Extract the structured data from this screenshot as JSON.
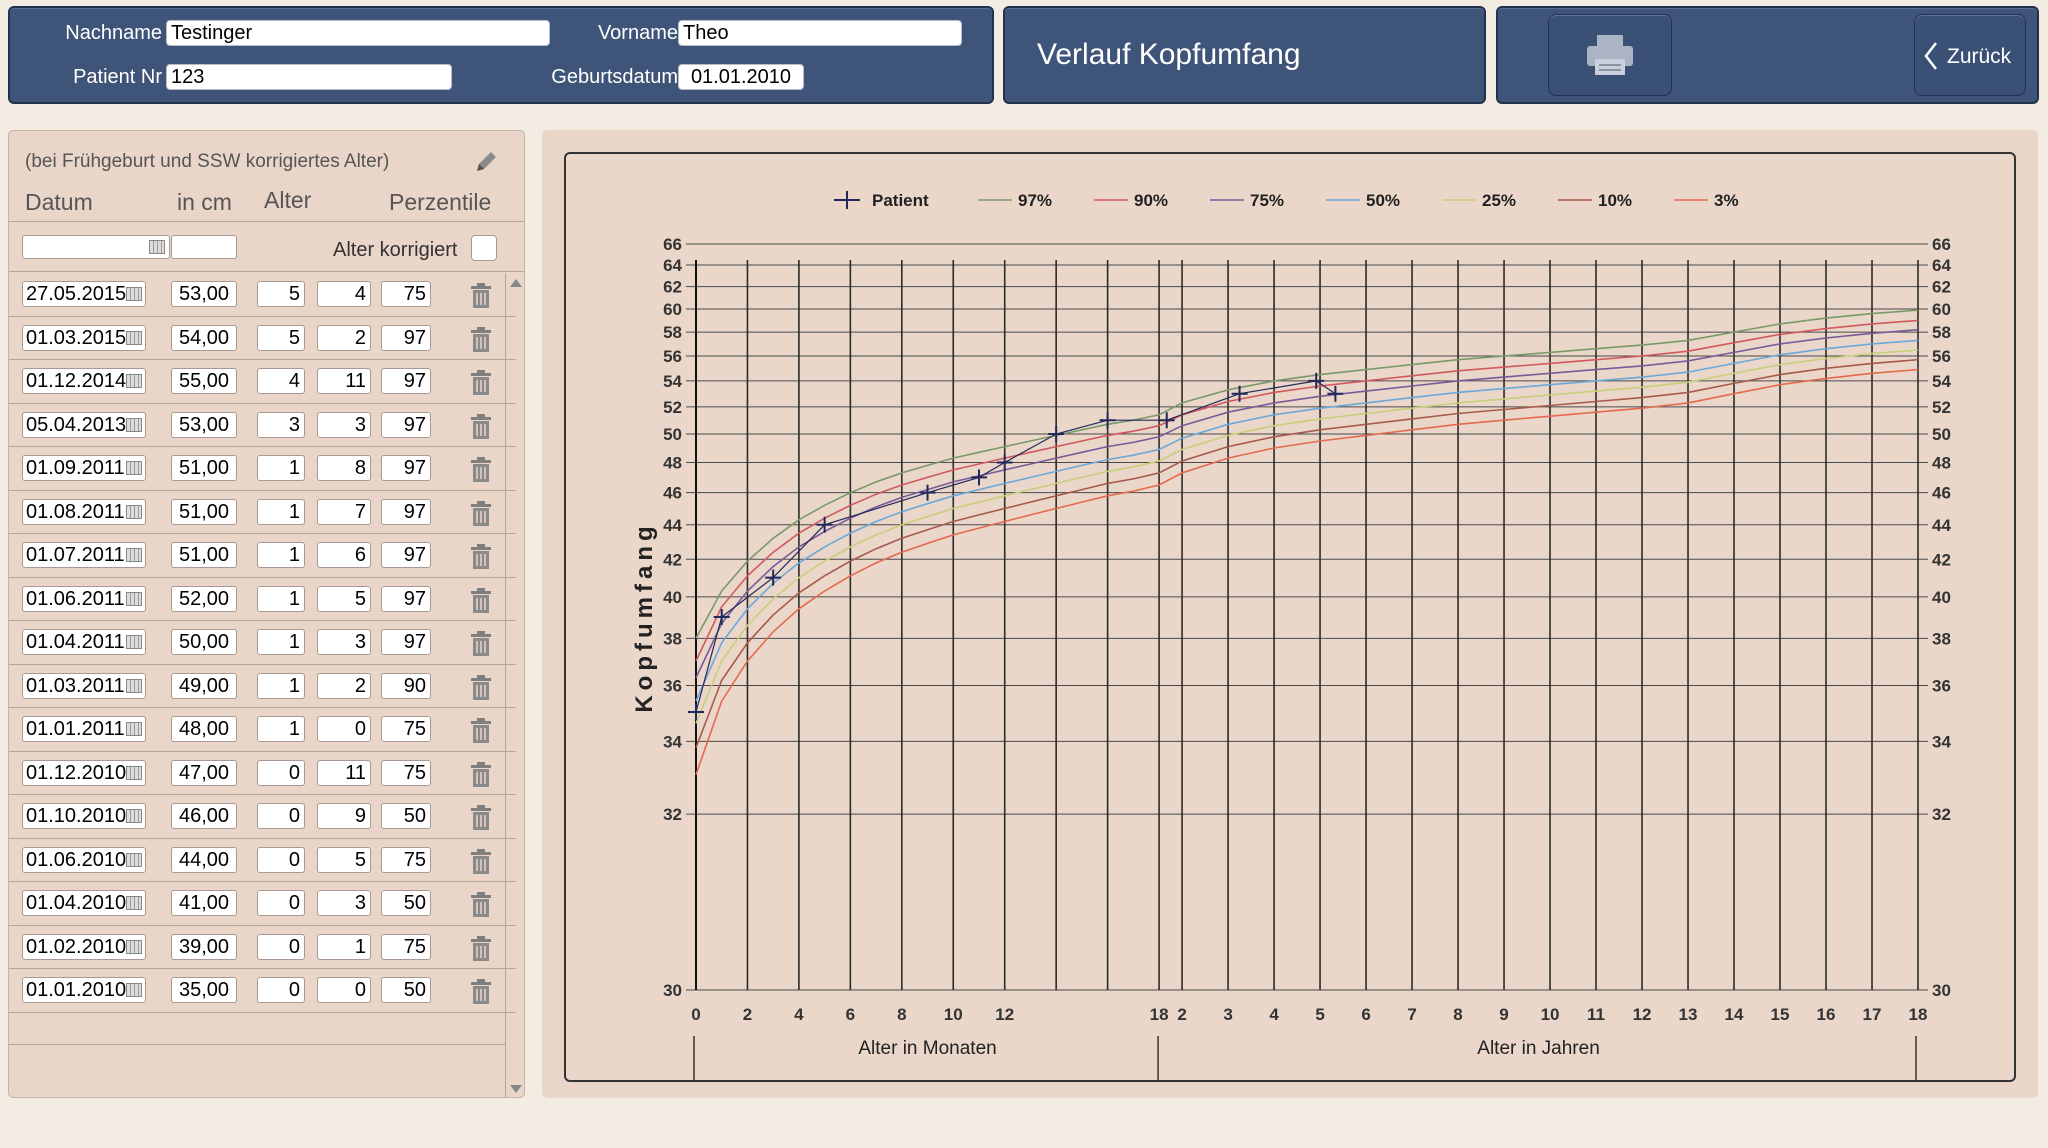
{
  "header": {
    "nachname_label": "Nachname",
    "nachname_value": "Testinger",
    "vorname_label": "Vorname",
    "vorname_value": "Theo",
    "patient_nr_label": "Patient Nr",
    "patient_nr_value": "123",
    "geburtsdatum_label": "Geburtsdatum",
    "geburtsdatum_value": "01.01.2010",
    "title": "Verlauf Kopfumfang",
    "back_label": "Zurück",
    "print_icon": "printer-icon",
    "back_icon": "chevron-left-icon"
  },
  "list": {
    "hint": "(bei Frühgeburt und SSW korrigiertes Alter)",
    "col_datum": "Datum",
    "col_cm": "in cm",
    "col_alter": "Alter",
    "col_perzentile": "Perzentile",
    "alter_korrigiert_label": "Alter korrigiert",
    "rows": [
      {
        "date": "27.05.2015",
        "cm": "53,00",
        "y": "5",
        "m": "4",
        "p": "75"
      },
      {
        "date": "01.03.2015",
        "cm": "54,00",
        "y": "5",
        "m": "2",
        "p": "97"
      },
      {
        "date": "01.12.2014",
        "cm": "55,00",
        "y": "4",
        "m": "11",
        "p": "97"
      },
      {
        "date": "05.04.2013",
        "cm": "53,00",
        "y": "3",
        "m": "3",
        "p": "97"
      },
      {
        "date": "01.09.2011",
        "cm": "51,00",
        "y": "1",
        "m": "8",
        "p": "97"
      },
      {
        "date": "01.08.2011",
        "cm": "51,00",
        "y": "1",
        "m": "7",
        "p": "97"
      },
      {
        "date": "01.07.2011",
        "cm": "51,00",
        "y": "1",
        "m": "6",
        "p": "97"
      },
      {
        "date": "01.06.2011",
        "cm": "52,00",
        "y": "1",
        "m": "5",
        "p": "97"
      },
      {
        "date": "01.04.2011",
        "cm": "50,00",
        "y": "1",
        "m": "3",
        "p": "97"
      },
      {
        "date": "01.03.2011",
        "cm": "49,00",
        "y": "1",
        "m": "2",
        "p": "90"
      },
      {
        "date": "01.01.2011",
        "cm": "48,00",
        "y": "1",
        "m": "0",
        "p": "75"
      },
      {
        "date": "01.12.2010",
        "cm": "47,00",
        "y": "0",
        "m": "11",
        "p": "75"
      },
      {
        "date": "01.10.2010",
        "cm": "46,00",
        "y": "0",
        "m": "9",
        "p": "50"
      },
      {
        "date": "01.06.2010",
        "cm": "44,00",
        "y": "0",
        "m": "5",
        "p": "75"
      },
      {
        "date": "01.04.2010",
        "cm": "41,00",
        "y": "0",
        "m": "3",
        "p": "50"
      },
      {
        "date": "01.02.2010",
        "cm": "39,00",
        "y": "0",
        "m": "1",
        "p": "75"
      },
      {
        "date": "01.01.2010",
        "cm": "35,00",
        "y": "0",
        "m": "0",
        "p": "50"
      }
    ]
  },
  "chart_data": {
    "type": "line",
    "ylabel": "Kopfumfang",
    "xlabel_months": "Alter in Monaten",
    "xlabel_years": "Alter in Jahren",
    "ylim": [
      30,
      66
    ],
    "y_scale": "sqrt",
    "y_ticks": [
      30,
      32,
      34,
      36,
      38,
      40,
      42,
      44,
      46,
      48,
      50,
      52,
      54,
      56,
      58,
      60,
      62,
      64,
      66
    ],
    "x_month_ticks": [
      "0",
      "2",
      "4",
      "6",
      "8",
      "10",
      "12",
      "18"
    ],
    "x_year_ticks": [
      "2",
      "3",
      "4",
      "5",
      "6",
      "7",
      "8",
      "9",
      "10",
      "11",
      "12",
      "13",
      "14",
      "15",
      "16",
      "17",
      "18"
    ],
    "x_age_months": [
      0,
      1,
      2,
      3,
      4,
      5,
      6,
      7,
      8,
      9,
      10,
      11,
      12,
      13,
      14,
      15,
      16,
      17,
      18,
      24,
      36,
      48,
      60,
      72,
      84,
      96,
      108,
      120,
      132,
      144,
      156,
      168,
      180,
      192,
      204,
      216
    ],
    "legend": {
      "patient": "Patient",
      "position": "top"
    },
    "series": [
      {
        "name": "97%",
        "color": "#7a9a6a",
        "values": [
          38.0,
          40.3,
          41.9,
          43.2,
          44.3,
          45.2,
          46.0,
          46.7,
          47.3,
          47.8,
          48.3,
          48.7,
          49.1,
          49.5,
          49.9,
          50.3,
          50.7,
          51.0,
          51.4,
          52.3,
          53.3,
          54.0,
          54.5,
          54.9,
          55.3,
          55.7,
          56.0,
          56.3,
          56.6,
          56.9,
          57.3,
          58.0,
          58.7,
          59.2,
          59.6,
          59.9
        ]
      },
      {
        "name": "90%",
        "color": "#d2585e",
        "values": [
          37.0,
          39.5,
          41.1,
          42.4,
          43.5,
          44.4,
          45.2,
          45.9,
          46.5,
          47.0,
          47.5,
          47.9,
          48.3,
          48.7,
          49.1,
          49.5,
          49.9,
          50.2,
          50.6,
          51.4,
          52.4,
          53.1,
          53.6,
          54.0,
          54.4,
          54.8,
          55.1,
          55.4,
          55.7,
          56.0,
          56.4,
          57.1,
          57.8,
          58.3,
          58.7,
          59.0
        ]
      },
      {
        "name": "75%",
        "color": "#7a5a9a",
        "values": [
          36.3,
          38.7,
          40.3,
          41.6,
          42.7,
          43.6,
          44.4,
          45.1,
          45.7,
          46.2,
          46.7,
          47.1,
          47.5,
          47.9,
          48.3,
          48.7,
          49.1,
          49.4,
          49.8,
          50.6,
          51.6,
          52.3,
          52.8,
          53.2,
          53.6,
          54.0,
          54.3,
          54.6,
          54.9,
          55.2,
          55.6,
          56.3,
          57.0,
          57.5,
          57.9,
          58.2
        ]
      },
      {
        "name": "50%",
        "color": "#6aa8d8",
        "values": [
          35.4,
          37.8,
          39.4,
          40.7,
          41.8,
          42.7,
          43.5,
          44.2,
          44.8,
          45.3,
          45.8,
          46.2,
          46.6,
          47.0,
          47.4,
          47.8,
          48.2,
          48.5,
          48.9,
          49.7,
          50.7,
          51.4,
          51.9,
          52.3,
          52.7,
          53.1,
          53.4,
          53.7,
          54.0,
          54.3,
          54.7,
          55.4,
          56.1,
          56.6,
          57.0,
          57.3
        ]
      },
      {
        "name": "25%",
        "color": "#c8cf7a",
        "values": [
          34.6,
          37.0,
          38.6,
          39.9,
          41.0,
          41.9,
          42.7,
          43.4,
          44.0,
          44.5,
          45.0,
          45.4,
          45.8,
          46.2,
          46.6,
          47.0,
          47.4,
          47.7,
          48.1,
          48.9,
          49.9,
          50.6,
          51.1,
          51.5,
          51.9,
          52.3,
          52.6,
          52.9,
          53.2,
          53.5,
          53.9,
          54.6,
          55.3,
          55.8,
          56.2,
          56.5
        ]
      },
      {
        "name": "10%",
        "color": "#a85a4a",
        "values": [
          33.8,
          36.2,
          37.8,
          39.1,
          40.2,
          41.1,
          41.9,
          42.6,
          43.2,
          43.7,
          44.2,
          44.6,
          45.0,
          45.4,
          45.8,
          46.2,
          46.6,
          46.9,
          47.3,
          48.1,
          49.1,
          49.8,
          50.3,
          50.7,
          51.1,
          51.5,
          51.8,
          52.1,
          52.4,
          52.7,
          53.1,
          53.8,
          54.5,
          55.0,
          55.4,
          55.7
        ]
      },
      {
        "name": "3%",
        "color": "#e46a4e",
        "values": [
          33.0,
          35.4,
          37.0,
          38.3,
          39.4,
          40.3,
          41.1,
          41.8,
          42.4,
          42.9,
          43.4,
          43.8,
          44.2,
          44.6,
          45.0,
          45.4,
          45.8,
          46.1,
          46.5,
          47.3,
          48.3,
          49.0,
          49.5,
          49.9,
          50.3,
          50.7,
          51.0,
          51.3,
          51.6,
          51.9,
          52.3,
          53.0,
          53.7,
          54.2,
          54.6,
          54.9
        ]
      }
    ],
    "patient": {
      "name": "Patient",
      "color": "#23285a",
      "points": [
        {
          "age_months": 0,
          "cm": 35
        },
        {
          "age_months": 1,
          "cm": 39
        },
        {
          "age_months": 3,
          "cm": 41
        },
        {
          "age_months": 5,
          "cm": 44
        },
        {
          "age_months": 9,
          "cm": 46
        },
        {
          "age_months": 11,
          "cm": 47
        },
        {
          "age_months": 12,
          "cm": 48
        },
        {
          "age_months": 14,
          "cm": 50
        },
        {
          "age_months": 16,
          "cm": 51
        },
        {
          "age_months": 20,
          "cm": 51
        },
        {
          "age_months": 39,
          "cm": 53
        },
        {
          "age_months": 59,
          "cm": 54
        },
        {
          "age_months": 64,
          "cm": 53
        }
      ]
    }
  }
}
